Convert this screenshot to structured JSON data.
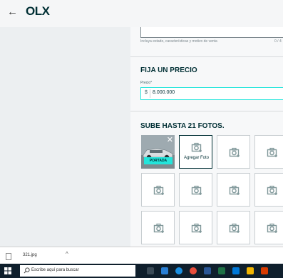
{
  "header": {
    "back_icon": "arrow-left-icon",
    "logo": "OLX"
  },
  "description": {
    "hint": "Incluya estado, características y motivo de venta",
    "counter": "0 / 4"
  },
  "price": {
    "title": "FIJA UN PRECIO",
    "label": "Precio*",
    "currency": "$",
    "value": "8.000.000"
  },
  "photos": {
    "title": "SUBE HASTA 21 FOTOS.",
    "cover_label": "PORTADA",
    "add_label": "Agregar Foto",
    "icon": "camera-plus-icon"
  },
  "downloads": {
    "file_name": "321.jpg",
    "caret": "^"
  },
  "taskbar": {
    "search_placeholder": "Escribe aquí para buscar"
  },
  "colors": {
    "accent": "#23e5db",
    "brand": "#002f34"
  }
}
